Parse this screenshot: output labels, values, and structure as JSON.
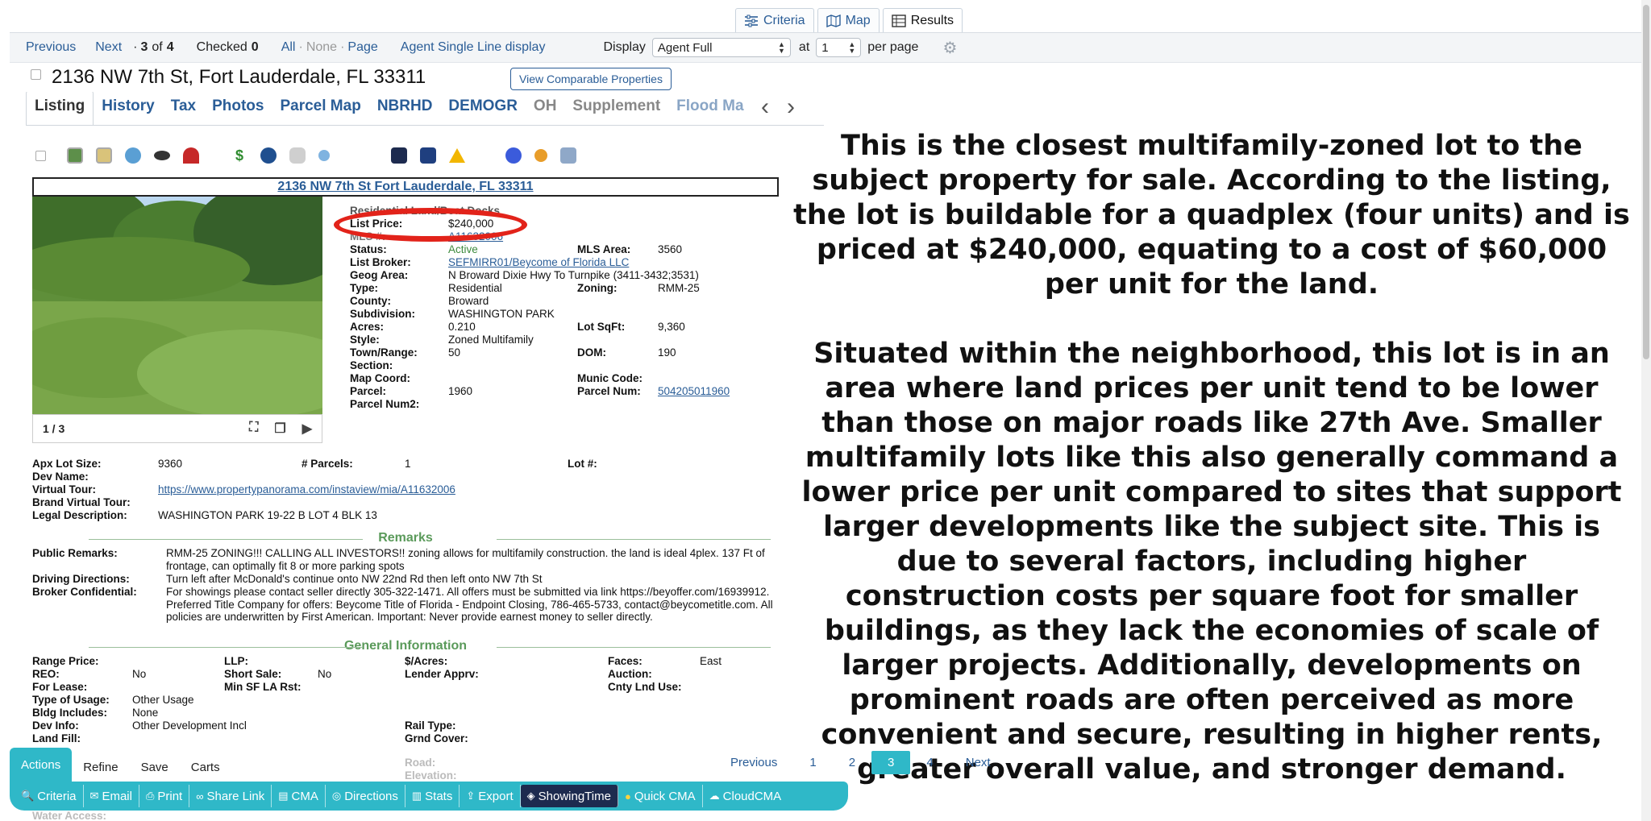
{
  "view_tabs": [
    {
      "label": "Criteria",
      "icon": "sliders-icon"
    },
    {
      "label": "Map",
      "icon": "map-icon"
    },
    {
      "label": "Results",
      "icon": "table-icon"
    }
  ],
  "nav": {
    "previous": "Previous",
    "next": "Next",
    "record_prefix": "·",
    "record_current": "3",
    "record_of": "of",
    "record_total": "4",
    "checked_label": "Checked",
    "checked_count": "0",
    "all": "All",
    "none": "None",
    "page": "Page",
    "dot": "·",
    "single_line": "Agent Single Line display",
    "display_label": "Display",
    "display_value": "Agent Full",
    "at_label": "at",
    "per_page_value": "1",
    "per_page_label": "per page"
  },
  "listing": {
    "address": "2136 NW 7th St, Fort Lauderdale, FL 33311",
    "comparable_button": "View Comparable Properties",
    "tabs": [
      "Listing",
      "History",
      "Tax",
      "Photos",
      "Parcel Map",
      "NBRHD",
      "DEMOGR",
      "OH",
      "Supplement",
      "Flood Ma"
    ],
    "header_link": "2136 NW 7th St Fort Lauderdale, FL 33311",
    "photo_counter": "1 / 3",
    "property_type": "Residential Land/Boat Docks",
    "facts": {
      "list_price_label": "List Price:",
      "list_price": "$240,000",
      "mls_label": "MLS #:",
      "mls": "A11632006",
      "status_label": "Status:",
      "status": "Active",
      "mls_area_label": "MLS Area:",
      "mls_area": "3560",
      "broker_label": "List Broker:",
      "broker": "SEFMIRR01/Beycome of Florida LLC",
      "geog_label": "Geog Area:",
      "geog": "N Broward Dixie Hwy To Turnpike (3411-3432;3531)",
      "type_label": "Type:",
      "type": "Residential",
      "zoning_label": "Zoning:",
      "zoning": "RMM-25",
      "county_label": "County:",
      "county": "Broward",
      "subdivision_label": "Subdivision:",
      "subdivision": "WASHINGTON PARK",
      "acres_label": "Acres:",
      "acres": "0.210",
      "lot_sqft_label": "Lot SqFt:",
      "lot_sqft": "9,360",
      "style_label": "Style:",
      "style": "Zoned Multifamily",
      "town_label": "Town/Range:",
      "town": "50",
      "dom_label": "DOM:",
      "dom": "190",
      "section_label": "Section:",
      "map_coord_label": "Map Coord:",
      "munic_label": "Munic Code:",
      "parcel_label": "Parcel:",
      "parcel": "1960",
      "parcel_num_label": "Parcel Num:",
      "parcel_num": "504205011960",
      "parcel_num2_label": "Parcel Num2:"
    },
    "extra": {
      "apx_lot_label": "Apx Lot Size:",
      "apx_lot": "9360",
      "parcels_label": "# Parcels:",
      "parcels": "1",
      "lot_num_label": "Lot #:",
      "dev_name_label": "Dev Name:",
      "virtual_tour_label": "Virtual Tour:",
      "virtual_tour": "https://www.propertypanorama.com/instaview/mia/A11632006",
      "brand_tour_label": "Brand Virtual Tour:",
      "legal_label": "Legal Description:",
      "legal": "WASHINGTON PARK 19-22 B LOT 4 BLK 13"
    },
    "remarks_title": "Remarks",
    "remarks": {
      "public_label": "Public Remarks:",
      "public": "RMM-25 ZONING!!! CALLING ALL INVESTORS!! zoning allows for multifamily construction. the land is ideal 4plex. 137 Ft of frontage, can optimally fit 8 or more parking spots",
      "driving_label": "Driving Directions:",
      "driving": "Turn left after McDonald's continue onto NW 22nd Rd then left onto NW 7th St",
      "broker_conf_label": "Broker Confidential:",
      "broker_conf": "For showings please contact seller directly 305-322-1471. All offers must be submitted via link https://beyoffer.com/16939912. Preferred Title Company for offers: Beycome Title of Florida - Endpoint Closing, 786-465-5733, contact@beycometitle.com. All policies are underwritten by First American. Important: Never provide earnest money to seller directly."
    },
    "general_title": "General Information",
    "general": {
      "range_price_label": "Range Price:",
      "llp_label": "LLP:",
      "per_acre_label": "$/Acres:",
      "faces_label": "Faces:",
      "faces": "East",
      "reo_label": "REO:",
      "reo": "No",
      "short_sale_label": "Short Sale:",
      "short_sale": "No",
      "lender_label": "Lender Apprv:",
      "auction_label": "Auction:",
      "for_lease_label": "For Lease:",
      "min_sf_label": "Min SF LA Rst:",
      "cnty_lnd_label": "Cnty Lnd Use:",
      "usage_label": "Type of Usage:",
      "usage": "Other Usage",
      "bldg_label": "Bldg Includes:",
      "bldg": "None",
      "dev_info_label": "Dev Info:",
      "dev_info": "Other Development Incl",
      "rail_label": "Rail Type:",
      "land_fill_label": "Land Fill:",
      "grnd_label": "Grnd Cover:",
      "road_label": "Road:",
      "elevation_label": "Elevation:",
      "water_label": "Water Access:"
    }
  },
  "commentary": [
    "This is the closest multifamily-zoned lot to the subject property for sale. According to the listing, the lot is buildable for a quadplex (four units) and is priced at $240,000, equating to a cost of $60,000 per unit for the land.",
    "Situated within the neighborhood, this lot is in an area where land prices per unit tend to be lower than those on major roads like 27th Ave. Smaller multifamily lots like this also generally command a lower price per unit compared to sites that support larger developments like the subject site. This is due to several factors, including higher construction costs per square foot for smaller buildings, as they lack the economies of scale of larger projects. Additionally, developments on prominent roads are often perceived as more convenient and secure, resulting in higher rents, greater overall value, and stronger demand."
  ],
  "actions": {
    "tabs": [
      "Actions",
      "Refine",
      "Save",
      "Carts"
    ],
    "buttons": [
      {
        "label": "Criteria",
        "icon": "search-icon"
      },
      {
        "label": "Email",
        "icon": "email-icon"
      },
      {
        "label": "Print",
        "icon": "print-icon"
      },
      {
        "label": "Share Link",
        "icon": "link-icon"
      },
      {
        "label": "CMA",
        "icon": "document-icon"
      },
      {
        "label": "Directions",
        "icon": "compass-icon"
      },
      {
        "label": "Stats",
        "icon": "stats-icon"
      },
      {
        "label": "Export",
        "icon": "export-icon"
      },
      {
        "label": "ShowingTime",
        "icon": "showingtime-icon"
      },
      {
        "label": "Quick CMA",
        "icon": "quick-cma-icon"
      },
      {
        "label": "CloudCMA",
        "icon": "cloud-icon"
      }
    ]
  },
  "pager": {
    "previous": "Previous",
    "pages": [
      "1",
      "2",
      "3",
      "4"
    ],
    "current": "3",
    "next": "Next"
  },
  "colors": {
    "link": "#2a5d97",
    "accent": "#2fb8c8",
    "status_active": "#3d8a3d",
    "highlight_oval": "#e2231a"
  }
}
